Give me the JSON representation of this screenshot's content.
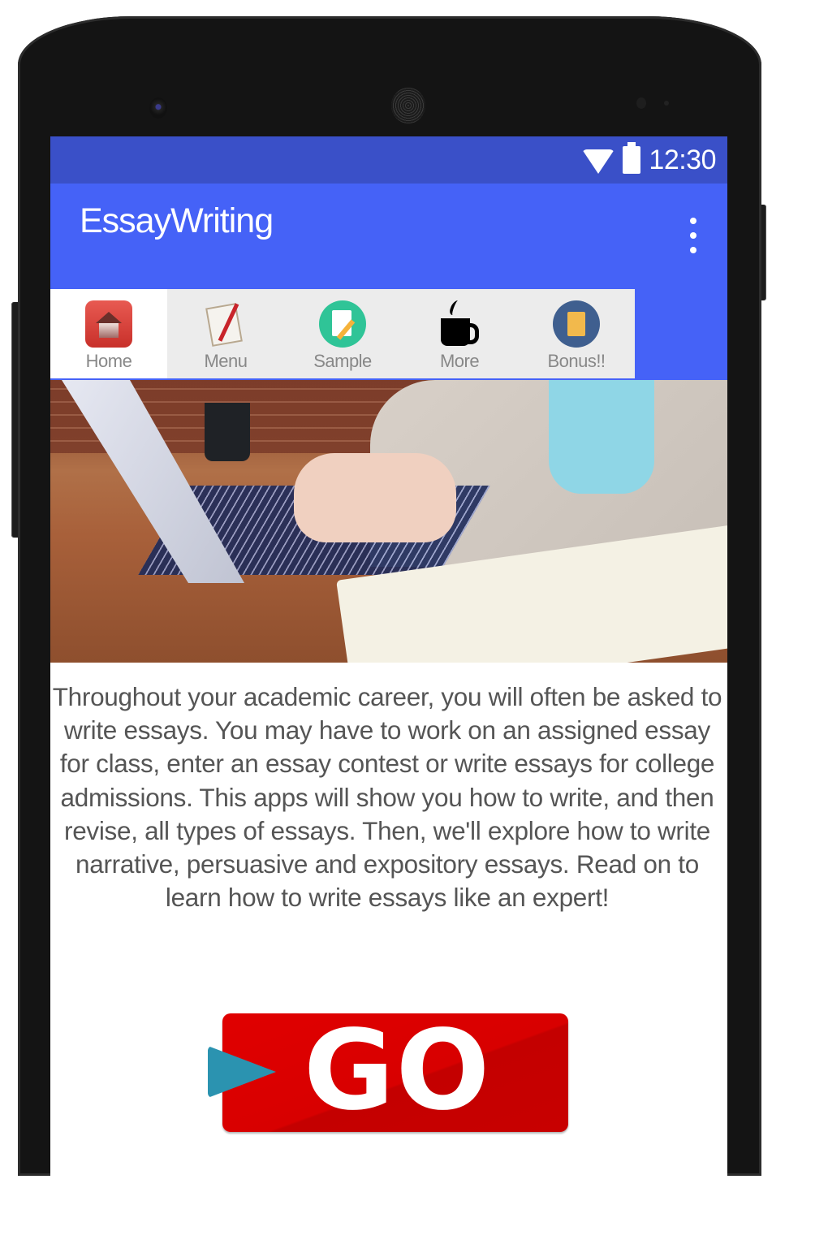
{
  "status_bar": {
    "wifi_icon": "wifi-icon",
    "battery_icon": "battery-icon",
    "time": "12:30"
  },
  "app_bar": {
    "title": "EssayWriting",
    "overflow_icon": "more-vert-icon"
  },
  "tabs": [
    {
      "label": "Home",
      "icon": "home-icon",
      "active": true
    },
    {
      "label": "Menu",
      "icon": "notepad-icon",
      "active": false
    },
    {
      "label": "Sample",
      "icon": "document-pencil-icon",
      "active": false
    },
    {
      "label": "More",
      "icon": "coffee-cup-icon",
      "active": false
    },
    {
      "label": "Bonus!!",
      "icon": "book-icon",
      "active": false
    }
  ],
  "hero_image": {
    "description": "Person typing on laptop at wooden desk with notebook and cup"
  },
  "body_text": "Throughout your academic career, you will often be asked to write essays. You may have to work on an assigned essay for class, enter an essay contest or write essays for college admissions. This apps will show you how to write, and then revise, all types of essays. Then, we'll explore how to write narrative, persuasive and expository essays. Read on to learn how to write essays like an expert!",
  "go_button": {
    "label": "GO",
    "icon": "play-icon"
  },
  "colors": {
    "status_bar": "#3a50c8",
    "app_bar": "#4562f7",
    "tab_background": "#ececec",
    "go_red": "#d80000",
    "play_teal": "#2b93b0"
  }
}
